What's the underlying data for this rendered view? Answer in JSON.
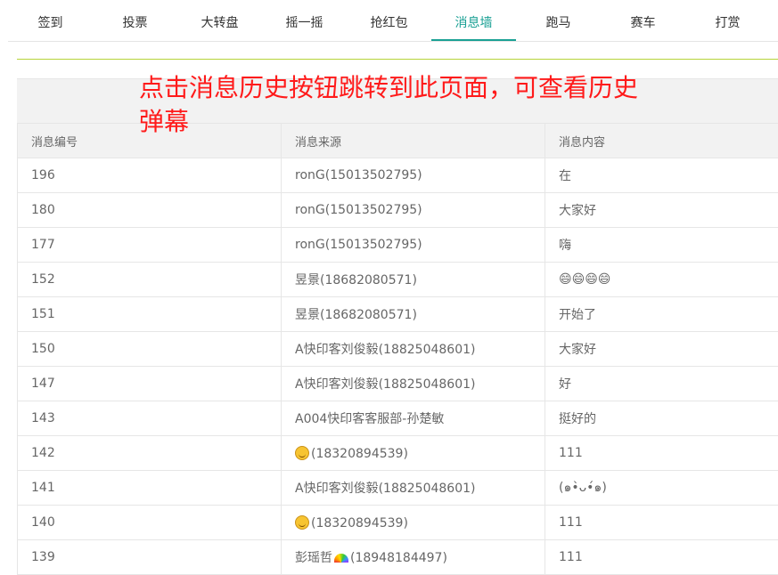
{
  "tabs": [
    {
      "label": "签到",
      "active": false
    },
    {
      "label": "投票",
      "active": false
    },
    {
      "label": "大转盘",
      "active": false
    },
    {
      "label": "摇一摇",
      "active": false
    },
    {
      "label": "抢红包",
      "active": false
    },
    {
      "label": "消息墙",
      "active": true
    },
    {
      "label": "跑马",
      "active": false
    },
    {
      "label": "赛车",
      "active": false
    },
    {
      "label": "打赏",
      "active": false
    }
  ],
  "annotation": "点击消息历史按钮跳转到此页面，可查看历史弹幕",
  "table": {
    "headers": [
      "消息编号",
      "消息来源",
      "消息内容"
    ],
    "rows": [
      {
        "id": "196",
        "source": "ronG(15013502795)",
        "content": "在"
      },
      {
        "id": "180",
        "source": "ronG(15013502795)",
        "content": "大家好"
      },
      {
        "id": "177",
        "source": "ronG(15013502795)",
        "content": "嗨"
      },
      {
        "id": "152",
        "source": "昱景(18682080571)",
        "content": "😄😄😄😄"
      },
      {
        "id": "151",
        "source": "昱景(18682080571)",
        "content": "开始了"
      },
      {
        "id": "150",
        "source": "A快印客刘俊毅(18825048601)",
        "content": "大家好"
      },
      {
        "id": "147",
        "source": "A快印客刘俊毅(18825048601)",
        "content": "好"
      },
      {
        "id": "143",
        "source": "A004快印客客服部-孙楚敏",
        "content": "挺好的"
      },
      {
        "id": "142",
        "source": "(18320894539)",
        "source_icon": "confused-face-emoji",
        "content": "111"
      },
      {
        "id": "141",
        "source": "A快印客刘俊毅(18825048601)",
        "content": "(๑•̀ᴗ•́๑)"
      },
      {
        "id": "140",
        "source": "(18320894539)",
        "source_icon": "confused-face-emoji",
        "content": "111"
      },
      {
        "id": "139",
        "source_name": "彭瑶哲",
        "source_icon": "rainbow-emoji",
        "source": "(18948184497)",
        "content": "111"
      }
    ]
  }
}
